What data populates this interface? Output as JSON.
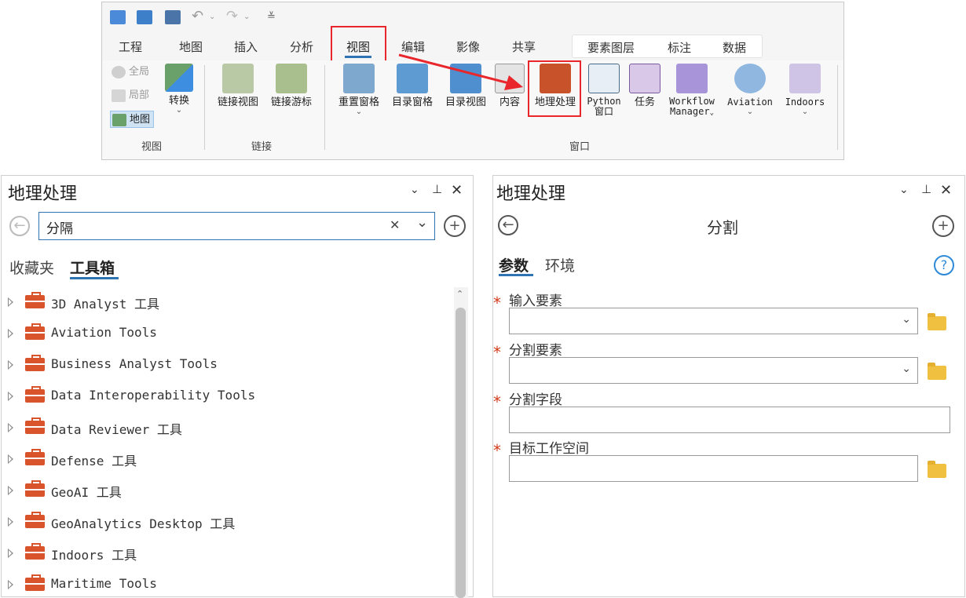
{
  "ribbon": {
    "qat_icons": [
      "new-project-icon",
      "open-project-icon",
      "save-project-icon",
      "undo-icon",
      "redo-icon",
      "customize-icon"
    ],
    "tabs": [
      "工程",
      "地图",
      "插入",
      "分析",
      "视图",
      "编辑",
      "影像",
      "共享"
    ],
    "contextual_tabs": [
      "要素图层",
      "标注",
      "数据"
    ],
    "view_group": {
      "global": "全局",
      "local": "局部",
      "map": "地图",
      "convert": "转换",
      "label": "视图"
    },
    "link_group": {
      "link_views": "链接视图",
      "link_cursor": "链接游标",
      "label": "链接"
    },
    "window_group": {
      "reset_panes": "重置窗格",
      "catalog_pane": "目录窗格",
      "catalog_view": "目录视图",
      "contents": "内容",
      "geoprocessing": "地理处理",
      "python_1": "Python",
      "python_2": "窗口",
      "tasks": "任务",
      "workflow_1": "Workflow",
      "workflow_2": "Manager",
      "aviation": "Aviation",
      "indoors": "Indoors",
      "label": "窗口"
    }
  },
  "left_pane": {
    "title": "地理处理",
    "search_value": "分隔",
    "tabs": [
      "收藏夹",
      "工具箱"
    ],
    "toolboxes": [
      "3D Analyst 工具",
      "Aviation Tools",
      "Business Analyst Tools",
      "Data Interoperability Tools",
      "Data Reviewer 工具",
      "Defense 工具",
      "GeoAI 工具",
      "GeoAnalytics Desktop 工具",
      "Indoors 工具",
      "Maritime Tools"
    ]
  },
  "right_pane": {
    "title": "地理处理",
    "tool_name": "分割",
    "tabs": [
      "参数",
      "环境"
    ],
    "params": [
      {
        "label": "输入要素",
        "value": ""
      },
      {
        "label": "分割要素",
        "value": ""
      },
      {
        "label": "分割字段",
        "value": ""
      },
      {
        "label": "目标工作空间",
        "value": ""
      }
    ]
  },
  "colors": {
    "highlight": "#e8262b",
    "accent": "#2e74b5",
    "toolbox": "#d9542b",
    "required": "#d23a1a"
  }
}
